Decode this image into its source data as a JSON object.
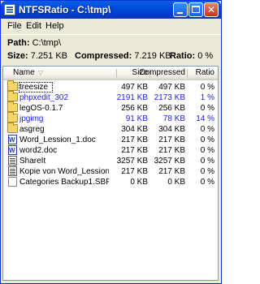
{
  "window": {
    "title": "NTFSRatio - C:\\tmp\\"
  },
  "menu": [
    "File",
    "Edit",
    "Help"
  ],
  "info": {
    "path_label": "Path:",
    "path_value": "C:\\tmp\\",
    "size_label": "Size:",
    "size_value": "7.251 KB",
    "compressed_label": "Compressed:",
    "compressed_value": "7.219 KB",
    "ratio_label": "Ratio:",
    "ratio_value": "0 %"
  },
  "columns": {
    "name": "Name",
    "size": "Size",
    "compressed": "Compressed",
    "ratio": "Ratio"
  },
  "rows": [
    {
      "icon": "folder-icon",
      "name": "treesize",
      "size": "497 KB",
      "compressed": "497 KB",
      "ratio": "0 %",
      "color": "#000000"
    },
    {
      "icon": "folder-icon",
      "name": "phpxedit_302",
      "size": "2191 KB",
      "compressed": "2173 KB",
      "ratio": "1 %",
      "color": "#2020E0"
    },
    {
      "icon": "folder-icon",
      "name": "legOS-0.1.7",
      "size": "256 KB",
      "compressed": "256 KB",
      "ratio": "0 %",
      "color": "#000000"
    },
    {
      "icon": "folder-icon",
      "name": "jpgimg",
      "size": "91 KB",
      "compressed": "78 KB",
      "ratio": "14 %",
      "color": "#2020E0"
    },
    {
      "icon": "folder-icon",
      "name": "asgreg",
      "size": "304 KB",
      "compressed": "304 KB",
      "ratio": "0 %",
      "color": "#000000"
    },
    {
      "icon": "word-doc-icon",
      "name": "Word_Lession_1.doc",
      "size": "217 KB",
      "compressed": "217 KB",
      "ratio": "0 %",
      "color": "#000000"
    },
    {
      "icon": "word-doc-icon",
      "name": "word2.doc",
      "size": "217 KB",
      "compressed": "217 KB",
      "ratio": "0 %",
      "color": "#000000"
    },
    {
      "icon": "executable-icon",
      "name": "ShareIt",
      "size": "3257 KB",
      "compressed": "3257 KB",
      "ratio": "0 %",
      "color": "#000000"
    },
    {
      "icon": "executable-icon",
      "name": "Kopie von Word_Lession_1....",
      "size": "217 KB",
      "compressed": "217 KB",
      "ratio": "0 %",
      "color": "#000000"
    },
    {
      "icon": "file-icon",
      "name": "Categories Backup1.SBF",
      "size": "0 KB",
      "compressed": "0 KB",
      "ratio": "0 %",
      "color": "#000000"
    }
  ]
}
